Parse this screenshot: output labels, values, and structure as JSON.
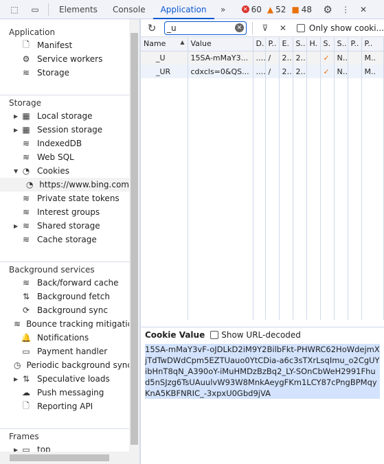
{
  "topbar": {
    "tabs": [
      "Elements",
      "Console",
      "Application"
    ],
    "active": "Application",
    "errors": "60",
    "warnings": "52",
    "issues": "48"
  },
  "sidebar": {
    "sections": [
      {
        "title": "Application",
        "items": [
          {
            "label": "Manifest",
            "icon": "file-icon",
            "g": "🗋"
          },
          {
            "label": "Service workers",
            "icon": "gears-icon",
            "g": "⚙"
          },
          {
            "label": "Storage",
            "icon": "database-icon",
            "g": "≋"
          }
        ]
      },
      {
        "title": "Storage",
        "items": [
          {
            "label": "Local storage",
            "icon": "table-icon",
            "g": "▦",
            "arrow": "▶"
          },
          {
            "label": "Session storage",
            "icon": "table-icon",
            "g": "▦",
            "arrow": "▶"
          },
          {
            "label": "IndexedDB",
            "icon": "database-icon",
            "g": "≋"
          },
          {
            "label": "Web SQL",
            "icon": "database-icon",
            "g": "≋"
          },
          {
            "label": "Cookies",
            "icon": "cookie-icon",
            "g": "◔",
            "arrow": "▼"
          },
          {
            "label": "https://www.bing.com",
            "icon": "cookie-icon",
            "g": "◔",
            "sub": true,
            "sel": true
          },
          {
            "label": "Private state tokens",
            "icon": "database-icon",
            "g": "≋"
          },
          {
            "label": "Interest groups",
            "icon": "database-icon",
            "g": "≋"
          },
          {
            "label": "Shared storage",
            "icon": "database-icon",
            "g": "≋",
            "arrow": "▶"
          },
          {
            "label": "Cache storage",
            "icon": "database-icon",
            "g": "≋"
          }
        ]
      },
      {
        "title": "Background services",
        "items": [
          {
            "label": "Back/forward cache",
            "icon": "database-icon",
            "g": "≋"
          },
          {
            "label": "Background fetch",
            "icon": "arrows-updown-icon",
            "g": "⇅"
          },
          {
            "label": "Background sync",
            "icon": "sync-icon",
            "g": "⟳"
          },
          {
            "label": "Bounce tracking mitigatic",
            "icon": "database-icon",
            "g": "≋"
          },
          {
            "label": "Notifications",
            "icon": "bell-icon",
            "g": "🔔"
          },
          {
            "label": "Payment handler",
            "icon": "card-icon",
            "g": "▭"
          },
          {
            "label": "Periodic background sync",
            "icon": "clock-icon",
            "g": "◷"
          },
          {
            "label": "Speculative loads",
            "icon": "arrows-updown-icon",
            "g": "⇅",
            "arrow": "▶"
          },
          {
            "label": "Push messaging",
            "icon": "cloud-icon",
            "g": "☁"
          },
          {
            "label": "Reporting API",
            "icon": "file-icon",
            "g": "🗋"
          }
        ]
      },
      {
        "title": "Frames",
        "items": [
          {
            "label": "top",
            "icon": "frame-icon",
            "g": "▭",
            "arrow": "▶"
          }
        ]
      }
    ]
  },
  "toolbar": {
    "filter_value": "_u",
    "only_show": "Only show cooki..."
  },
  "table": {
    "columns": [
      "Name",
      "Value",
      "D.",
      "P..",
      "E.",
      "S..",
      "H.",
      "S.",
      "S..",
      "P..",
      "P.."
    ],
    "rows": [
      [
        "_U",
        "15SA-mMaY3...",
        "....",
        "/",
        "2...",
        "2...",
        "",
        "✓",
        "N..",
        "",
        "M.."
      ],
      [
        "_UR",
        "cdxcls=0&QS...",
        "....",
        "/",
        "2...",
        "2...",
        "",
        "✓",
        "N..",
        "",
        "M.."
      ]
    ]
  },
  "cookie_value": {
    "title": "Cookie Value",
    "show_decoded": "Show URL-decoded",
    "value": "15SA-mMaY3vF-oJDLkD2iM9Y2BilbFkt-PHWRC62HoWdejmXjTdTwDWdCpm5EZTUauo0YtCDia-a6c3sTXrLsqImu_o2CgUYibHnT8qN_A390oY-iMuHMDzBzBq2_LY-SOnCbWeH2991Fhud5nSJzg6TsUAuulvW93W8MnkAeygFKm1LCY87cPngBPMqyKnA5KBFNRIC_-3xpxU0Gbd9jVA"
  }
}
